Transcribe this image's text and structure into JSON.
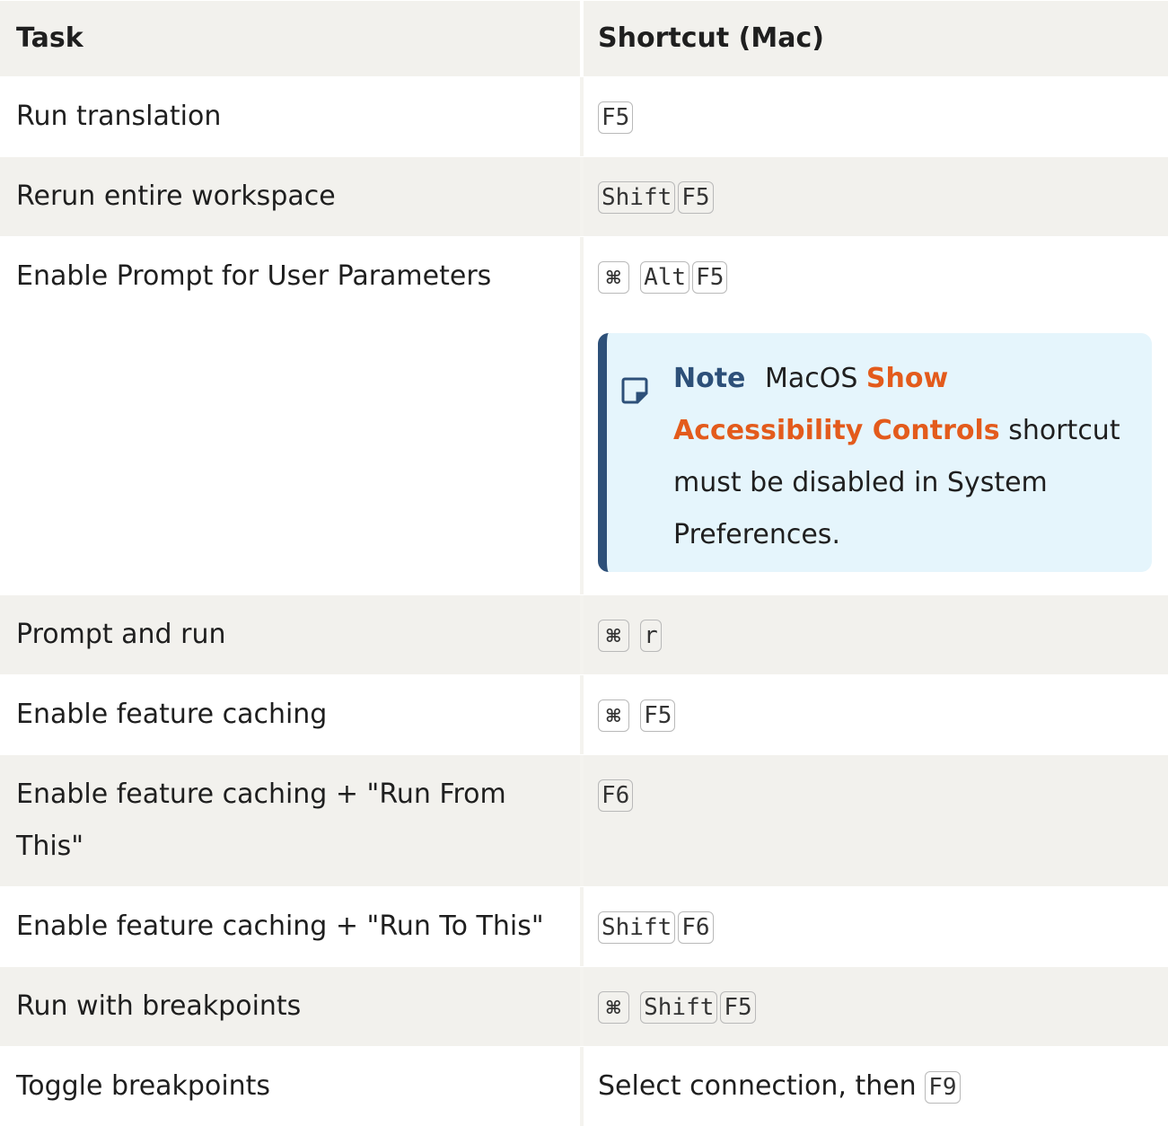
{
  "header": {
    "task": "Task",
    "shortcut": "Shortcut (Mac)"
  },
  "rows": [
    {
      "task": "Run translation",
      "keys": [
        "F5"
      ]
    },
    {
      "task": "Rerun entire workspace",
      "keys": [
        "Shift",
        "F5"
      ]
    },
    {
      "task": "Enable Prompt for User Parameters",
      "keys": [
        "⌘",
        "Alt",
        "F5"
      ],
      "note": {
        "label": "Note",
        "text_before": "MacOS",
        "emphasis": "Show Accessibility Controls",
        "text_after": "shortcut must be disabled in System Preferences.",
        "icon": "note-icon"
      }
    },
    {
      "task": "Prompt and run",
      "keys": [
        "⌘",
        "r"
      ]
    },
    {
      "task": "Enable feature caching",
      "keys": [
        "⌘",
        "F5"
      ]
    },
    {
      "task": "Enable feature caching + \"Run From This\"",
      "keys": [
        "F6"
      ]
    },
    {
      "task": "Enable feature caching + \"Run To This\"",
      "keys": [
        "Shift",
        "F6"
      ]
    },
    {
      "task": "Run with breakpoints",
      "keys": [
        "⌘",
        "Shift",
        "F5"
      ]
    },
    {
      "task": "Toggle breakpoints",
      "prefix": "Select connection, then",
      "keys": [
        "F9"
      ]
    }
  ],
  "colors": {
    "row_shade": "#f2f1ed",
    "note_bg": "#e5f5fc",
    "note_accent": "#2d5079",
    "emphasis": "#e35b1c"
  }
}
